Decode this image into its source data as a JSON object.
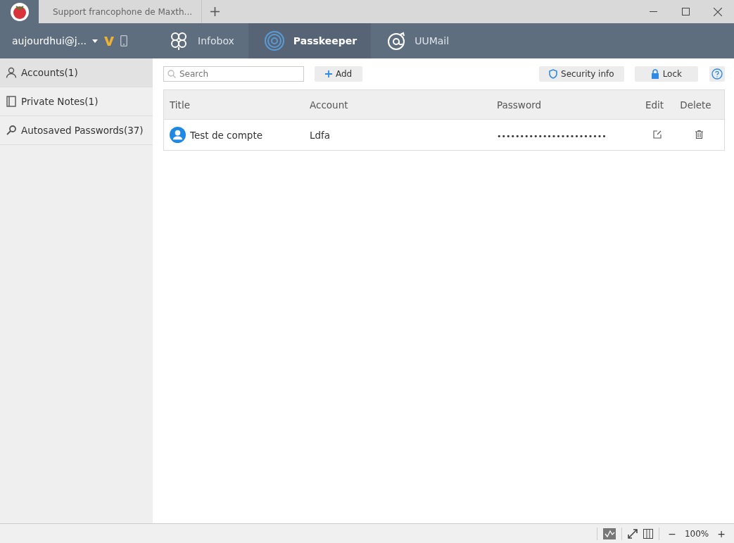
{
  "browser_tabs": [
    {
      "title": "Support francophone de Maxth...",
      "kind": "page"
    }
  ],
  "header": {
    "account": "aujourdhui@j...",
    "apps": [
      {
        "kind": "infobox",
        "label": "Infobox",
        "selected": false
      },
      {
        "kind": "passkeeper",
        "label": "Passkeeper",
        "selected": true
      },
      {
        "kind": "uumail",
        "label": "UUMail",
        "selected": false
      }
    ]
  },
  "sidebar": {
    "items": [
      {
        "kind": "accounts",
        "label": "Accounts(1)",
        "selected": true
      },
      {
        "kind": "notes",
        "label": "Private Notes(1)",
        "selected": false
      },
      {
        "kind": "autosaved",
        "label": "Autosaved Passwords(37)",
        "selected": false
      }
    ]
  },
  "toolbar": {
    "search": {
      "placeholder": "Search"
    },
    "add": "Add",
    "security": "Security info",
    "lock": "Lock"
  },
  "table": {
    "columns": [
      "Title",
      "Account",
      "Password",
      "Edit",
      "Delete"
    ],
    "rows": [
      {
        "title": "Test de compte",
        "account": "Ldfa",
        "password": "••••••••••••••••••••••••"
      }
    ]
  },
  "status_bar": {
    "zoom": "100%",
    "zoom_out": "−",
    "zoom_in": "+"
  }
}
